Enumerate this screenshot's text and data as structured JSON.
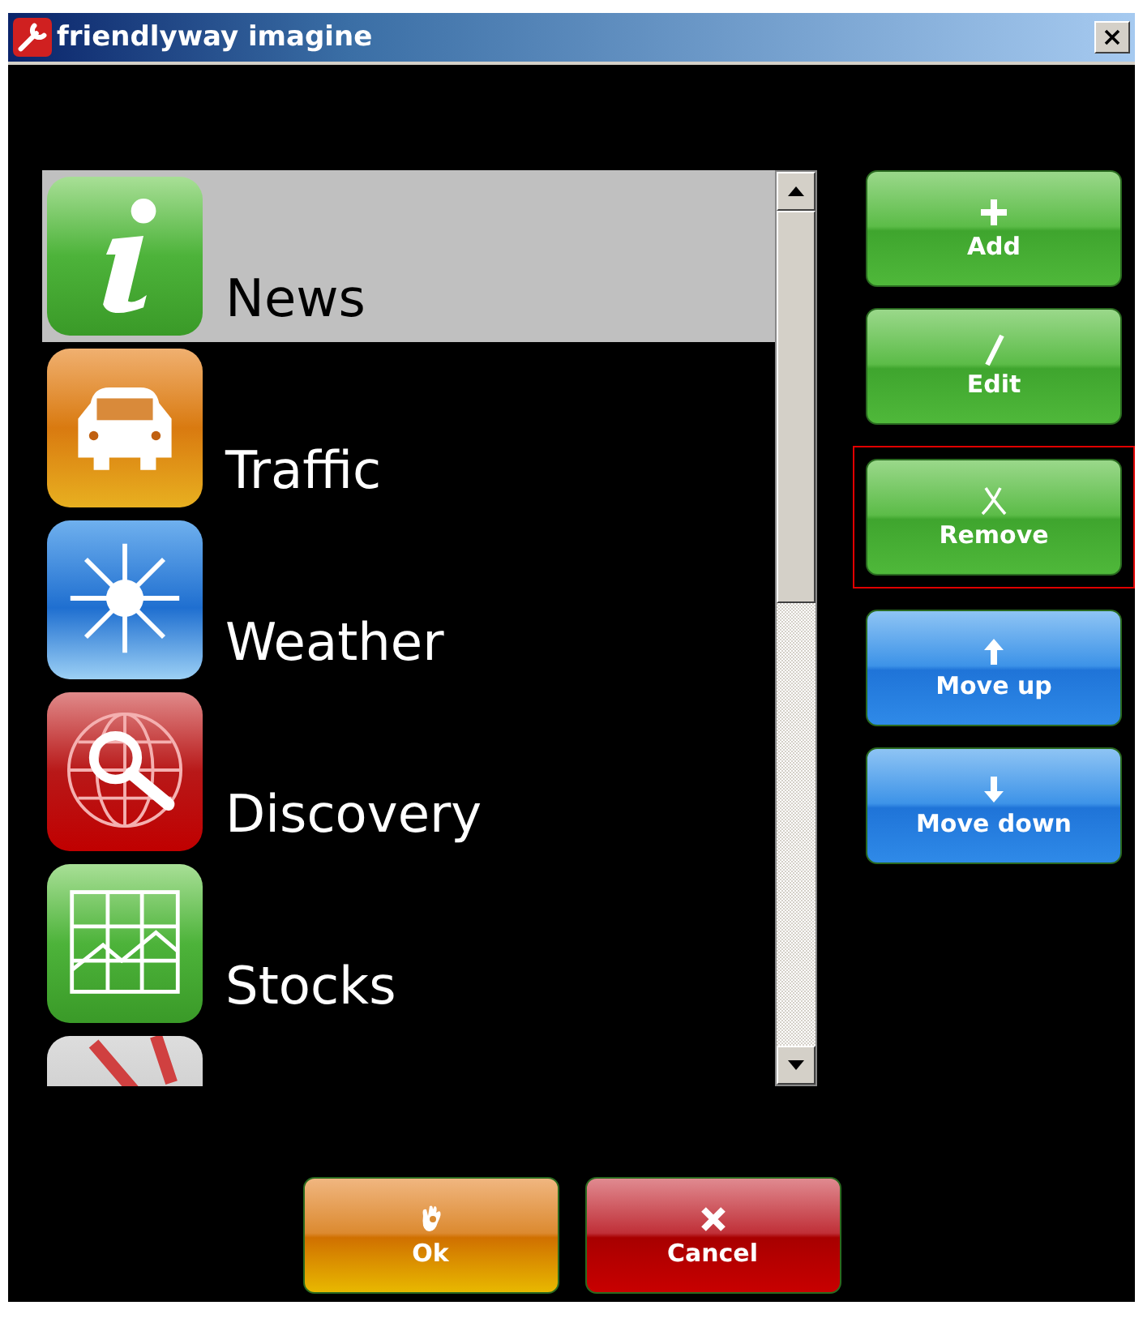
{
  "window": {
    "title": "friendlyway imagine"
  },
  "list": {
    "items": [
      {
        "label": "News",
        "selected": true
      },
      {
        "label": "Traffic",
        "selected": false
      },
      {
        "label": "Weather",
        "selected": false
      },
      {
        "label": "Discovery",
        "selected": false
      },
      {
        "label": "Stocks",
        "selected": false
      },
      {
        "selected": false
      }
    ]
  },
  "side_buttons": [
    {
      "label": "Add",
      "kind": "green",
      "focused": false
    },
    {
      "label": "Edit",
      "kind": "green",
      "focused": false
    },
    {
      "label": "Remove",
      "kind": "green",
      "focused": true
    },
    {
      "label": "Move up",
      "kind": "blue",
      "focused": false
    },
    {
      "label": "Move down",
      "kind": "blue",
      "focused": false
    }
  ],
  "bottom_buttons": [
    {
      "label": "Ok",
      "kind": "orange"
    },
    {
      "label": "Cancel",
      "kind": "red"
    }
  ]
}
